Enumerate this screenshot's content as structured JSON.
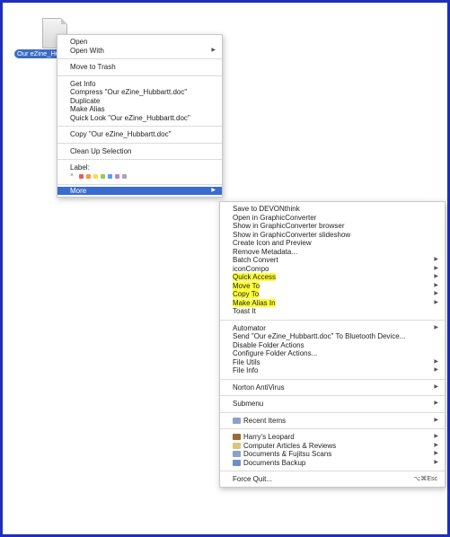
{
  "file": {
    "label": "Our eZine_Hu"
  },
  "context_menu": {
    "group1": [
      "Open",
      "Open With"
    ],
    "group2": [
      "Move to Trash"
    ],
    "group3": [
      "Get Info",
      "Compress \"Our eZine_Hubbartt.doc\"",
      "Duplicate",
      "Make Alias",
      "Quick Look \"Our eZine_Hubbartt.doc\""
    ],
    "group4": [
      "Copy \"Our eZine_Hubbartt.doc\""
    ],
    "group5": [
      "Clean Up Selection"
    ],
    "label_title": "Label:",
    "label_x": "×",
    "label_colors": [
      "#ec5a5a",
      "#f39a3c",
      "#f1df4a",
      "#93cc55",
      "#5d9ce4",
      "#b784d8",
      "#a8a8a8"
    ],
    "more": "More"
  },
  "submenu": {
    "group1": [
      {
        "label": "Save to DEVONthink",
        "arrow": false
      },
      {
        "label": "Open in GraphicConverter",
        "arrow": false
      },
      {
        "label": "Show in GraphicConverter browser",
        "arrow": false
      },
      {
        "label": "Show in GraphicConverter slideshow",
        "arrow": false
      },
      {
        "label": "Create Icon and Preview",
        "arrow": false
      },
      {
        "label": "Remove Metadata...",
        "arrow": false
      },
      {
        "label": "Batch Convert",
        "arrow": true
      },
      {
        "label": "iconCompo",
        "arrow": true
      },
      {
        "label": "Quick Access",
        "arrow": true,
        "highlight": true
      },
      {
        "label": "Move To",
        "arrow": true,
        "highlight": true
      },
      {
        "label": "Copy To",
        "arrow": true,
        "highlight": true
      },
      {
        "label": "Make Alias In",
        "arrow": true,
        "highlight": true
      },
      {
        "label": "Toast It",
        "arrow": false
      }
    ],
    "group2": [
      {
        "label": "Automator",
        "arrow": true
      },
      {
        "label": "Send \"Our eZine_Hubbartt.doc\" To Bluetooth Device...",
        "arrow": false
      },
      {
        "label": "Disable Folder Actions",
        "arrow": false
      },
      {
        "label": "Configure Folder Actions...",
        "arrow": false
      },
      {
        "label": "File Utils",
        "arrow": true
      },
      {
        "label": "File Info",
        "arrow": true
      }
    ],
    "norton": "Norton AntiVirus",
    "submenu_item": "Submenu",
    "recent": "Recent Items",
    "places": [
      {
        "label": "Harry's Leopard",
        "icon": "hard-drive-icon",
        "color": "#9a6a3a"
      },
      {
        "label": "Computer Articles & Reviews",
        "icon": "document-icon",
        "color": "#d9c77a"
      },
      {
        "label": "Documents & Fujitsu Scans",
        "icon": "folder-icon",
        "color": "#8aa2c8"
      },
      {
        "label": "Documents Backup",
        "icon": "backup-folder-icon",
        "color": "#6f8fc0"
      }
    ],
    "force_quit": "Force Quit...",
    "force_quit_shortcut": "⌥⌘Esc"
  }
}
